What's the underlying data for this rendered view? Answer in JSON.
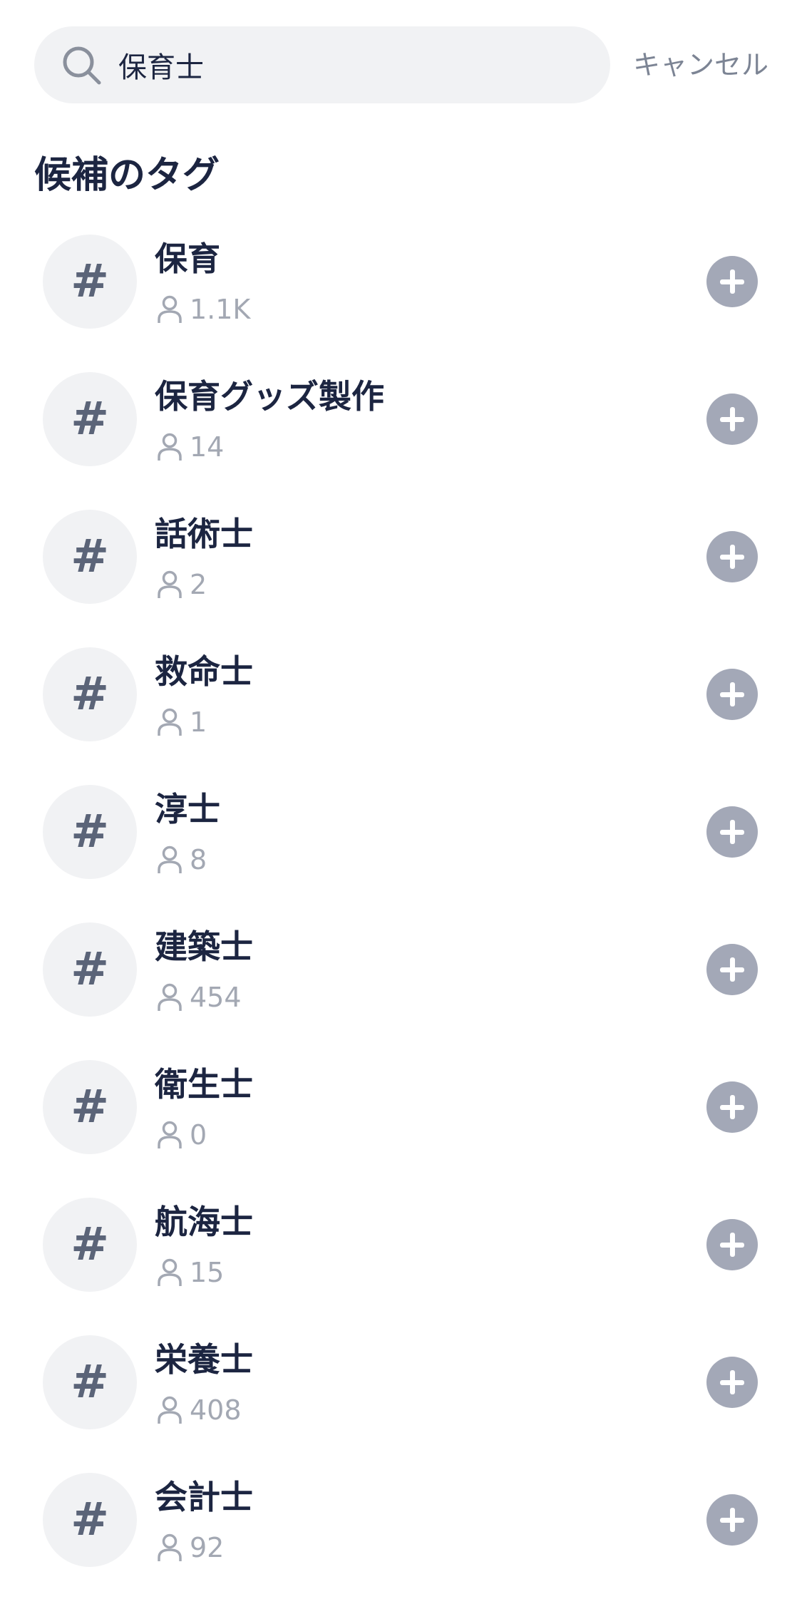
{
  "search": {
    "query": "保育士",
    "icon": "search-icon",
    "cancel_label": "キャンセル"
  },
  "section": {
    "title": "候補のタグ"
  },
  "colors": {
    "text_primary": "#1c2541",
    "text_secondary": "#a3a8b3",
    "search_background": "#f1f2f4",
    "add_button": "#a3a8b7"
  },
  "tags": [
    {
      "hash": "#",
      "name": "保育",
      "count": "1.1K",
      "icon": "person-icon"
    },
    {
      "hash": "#",
      "name": "保育グッズ製作",
      "count": "14",
      "icon": "person-icon"
    },
    {
      "hash": "#",
      "name": "話術士",
      "count": "2",
      "icon": "person-icon"
    },
    {
      "hash": "#",
      "name": "救命士",
      "count": "1",
      "icon": "person-icon"
    },
    {
      "hash": "#",
      "name": "淳士",
      "count": "8",
      "icon": "person-icon"
    },
    {
      "hash": "#",
      "name": "建築士",
      "count": "454",
      "icon": "person-icon"
    },
    {
      "hash": "#",
      "name": "衛生士",
      "count": "0",
      "icon": "person-icon"
    },
    {
      "hash": "#",
      "name": "航海士",
      "count": "15",
      "icon": "person-icon"
    },
    {
      "hash": "#",
      "name": "栄養士",
      "count": "408",
      "icon": "person-icon"
    },
    {
      "hash": "#",
      "name": "会計士",
      "count": "92",
      "icon": "person-icon"
    }
  ]
}
